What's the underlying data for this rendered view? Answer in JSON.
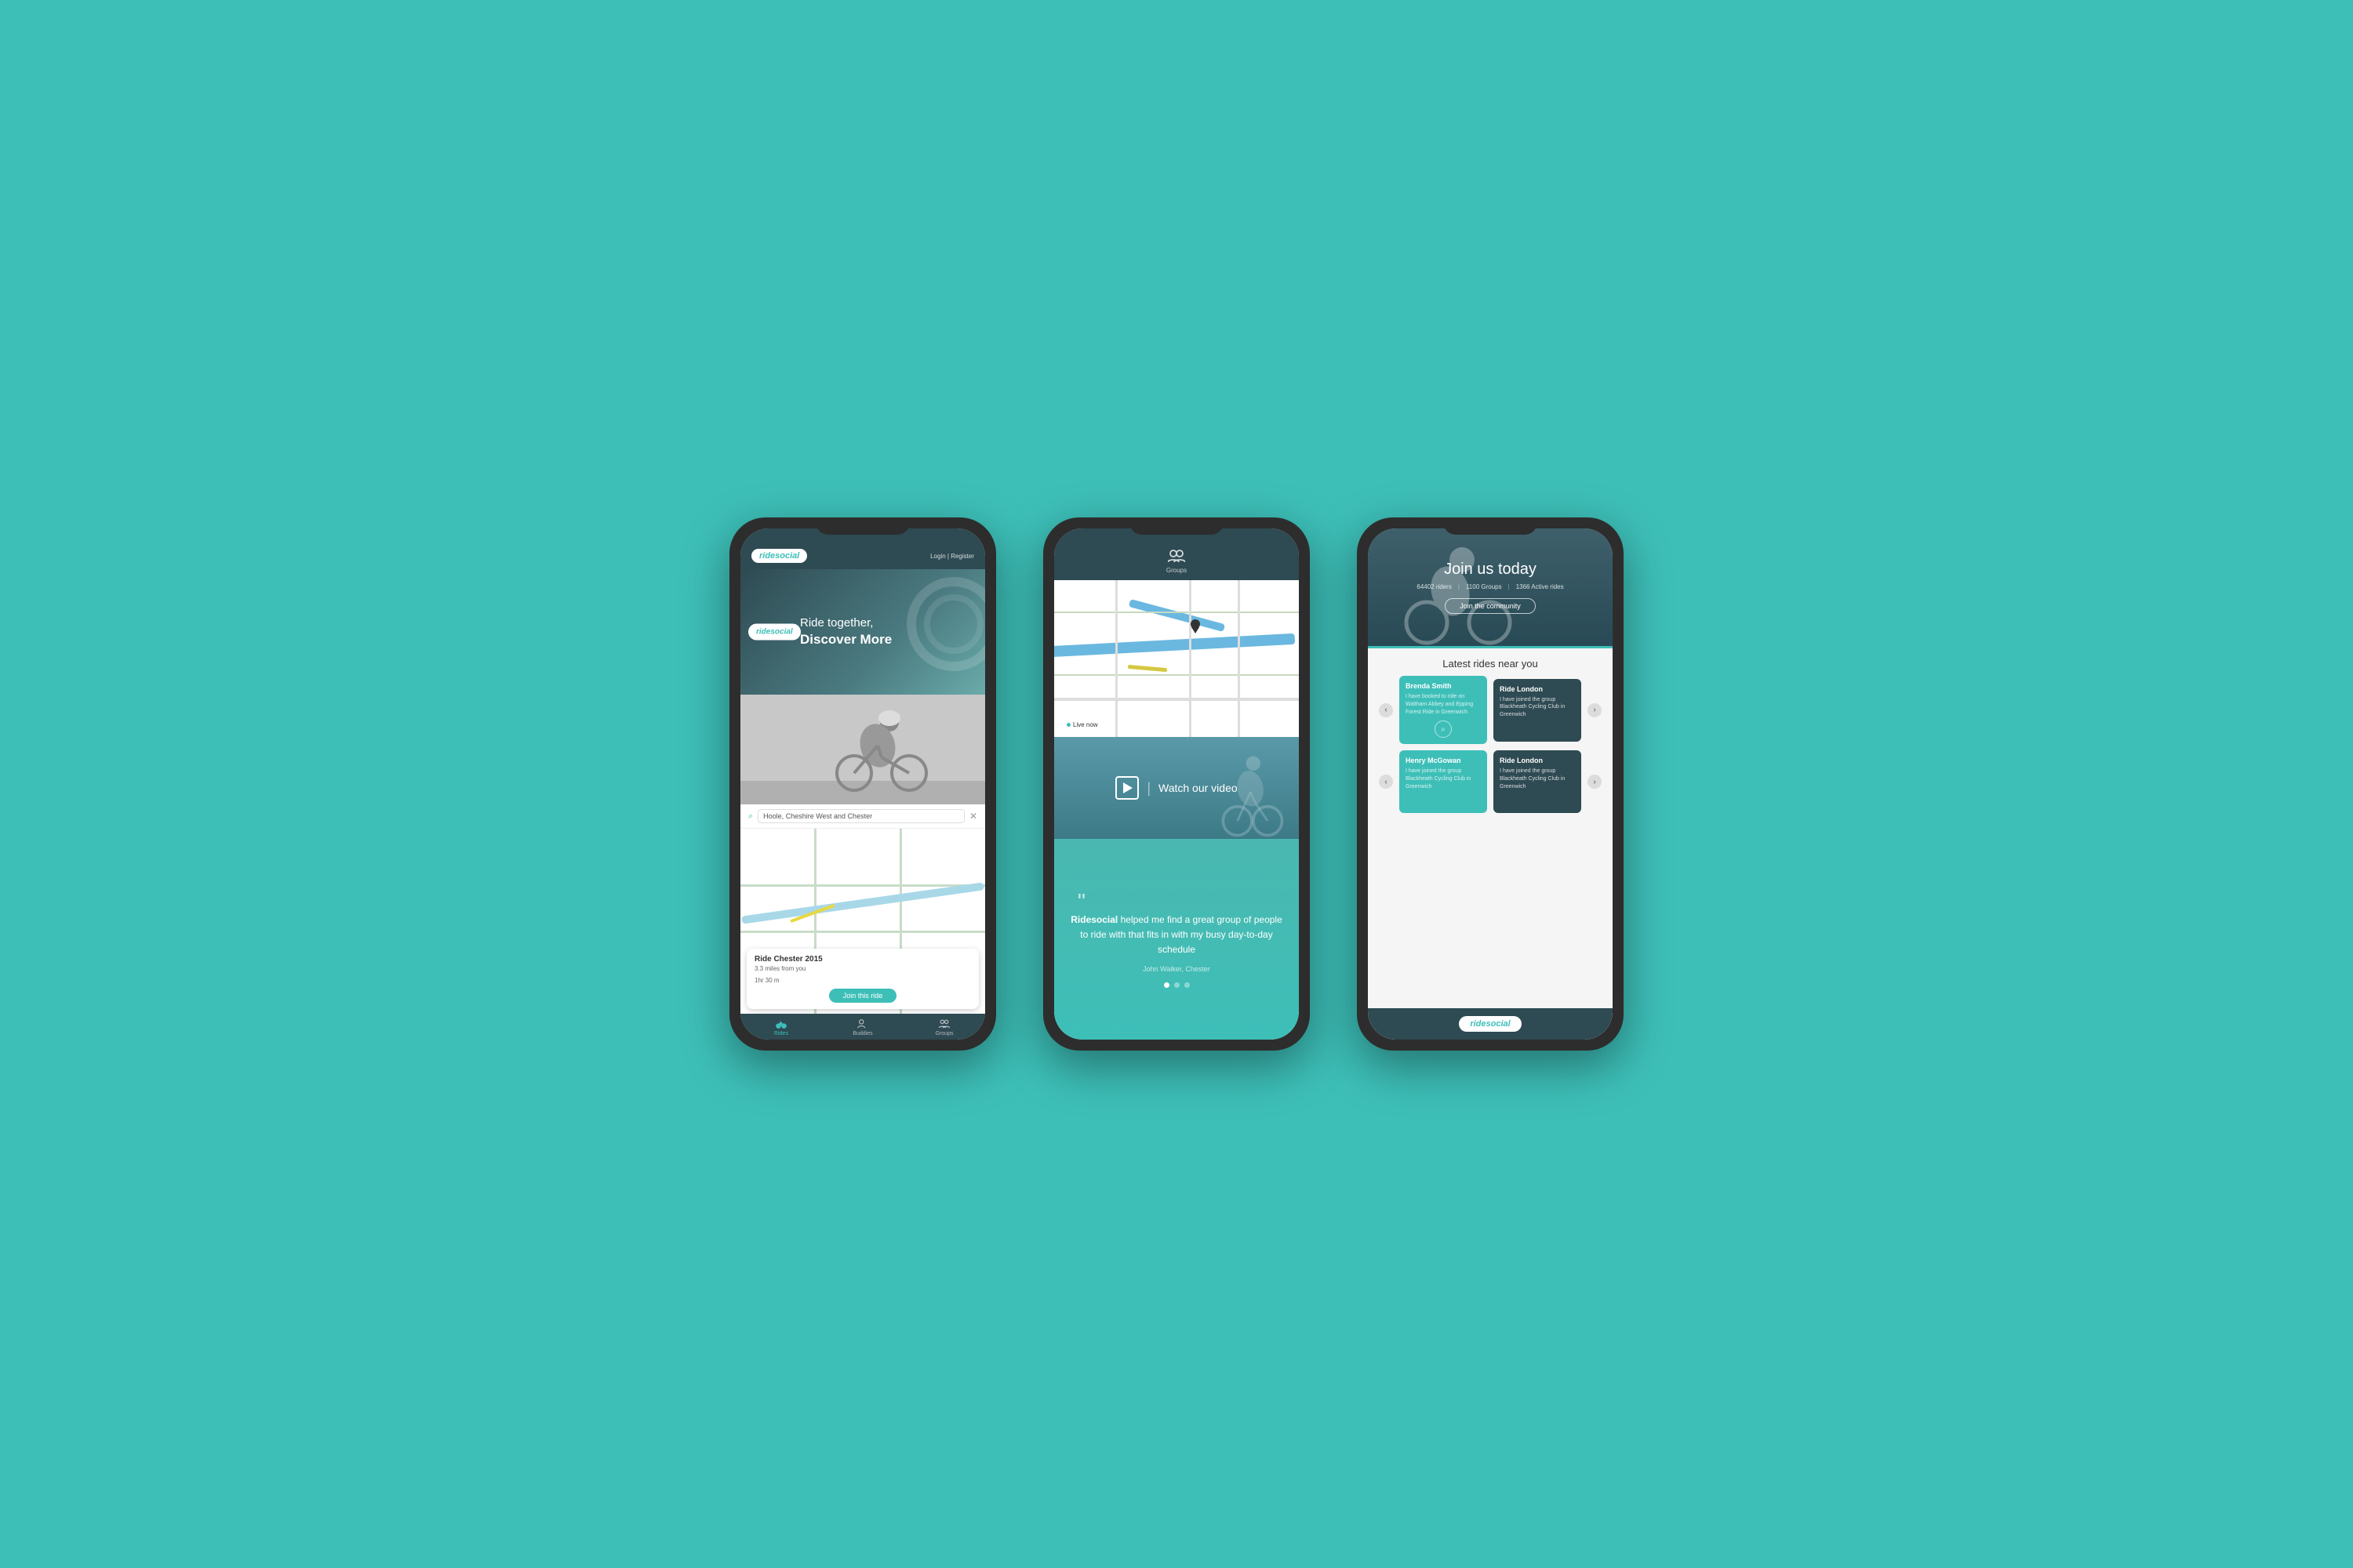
{
  "background": "#3dbfb8",
  "phone1": {
    "logo": "ridesocial",
    "nav": "Login | Register",
    "hero_tagline_light": "Ride together,",
    "hero_tagline_bold": "Discover More",
    "search_placeholder": "Hoole, Cheshire West and Chester",
    "ride_title": "Ride Chester 2015",
    "ride_distance": "3.3 miles from you",
    "ride_time": "1hr 30 m",
    "join_btn": "Join this ride",
    "tabs": [
      {
        "id": "rides",
        "label": "Rides",
        "active": true
      },
      {
        "id": "buddies",
        "label": "Buddies",
        "active": false
      },
      {
        "id": "groups",
        "label": "Groups",
        "active": false
      }
    ]
  },
  "phone2": {
    "nav_label": "Groups",
    "live_label": "Live now",
    "watch_video_text": "Watch our video",
    "testimonial_brand": "Ridesocial",
    "testimonial_text": " helped me find a great group of people to ride with that fits in with my busy day-to-day schedule",
    "testimonial_author": "John Walker, Chester",
    "dots": [
      {
        "active": true
      },
      {
        "active": false
      },
      {
        "active": false
      }
    ]
  },
  "phone3": {
    "hero_title": "Join us today",
    "stat_riders": "64402 riders",
    "stat_groups": "1100 Groups",
    "stat_active": "1366 Active rides",
    "join_community_btn": "Join the community",
    "section_title": "Latest rides near you",
    "rides": [
      {
        "title": "Brenda Smith",
        "text": "I have booked to ride on Waltham Abbey and Epping Forest Ride in Greenwich",
        "color": "teal"
      },
      {
        "title": "Ride London",
        "text": "I have joined the group Blackheath Cycling Club in Greenwich",
        "color": "dark"
      },
      {
        "title": "Henry McGowan",
        "text": "I have joined the group Blackheath Cycling Club in Greenwich",
        "color": "teal"
      },
      {
        "title": "Ride London",
        "text": "I have joined the group Blackheath Cycling Club in Greenwich",
        "color": "dark"
      }
    ],
    "footer_logo": "ridesocial"
  }
}
